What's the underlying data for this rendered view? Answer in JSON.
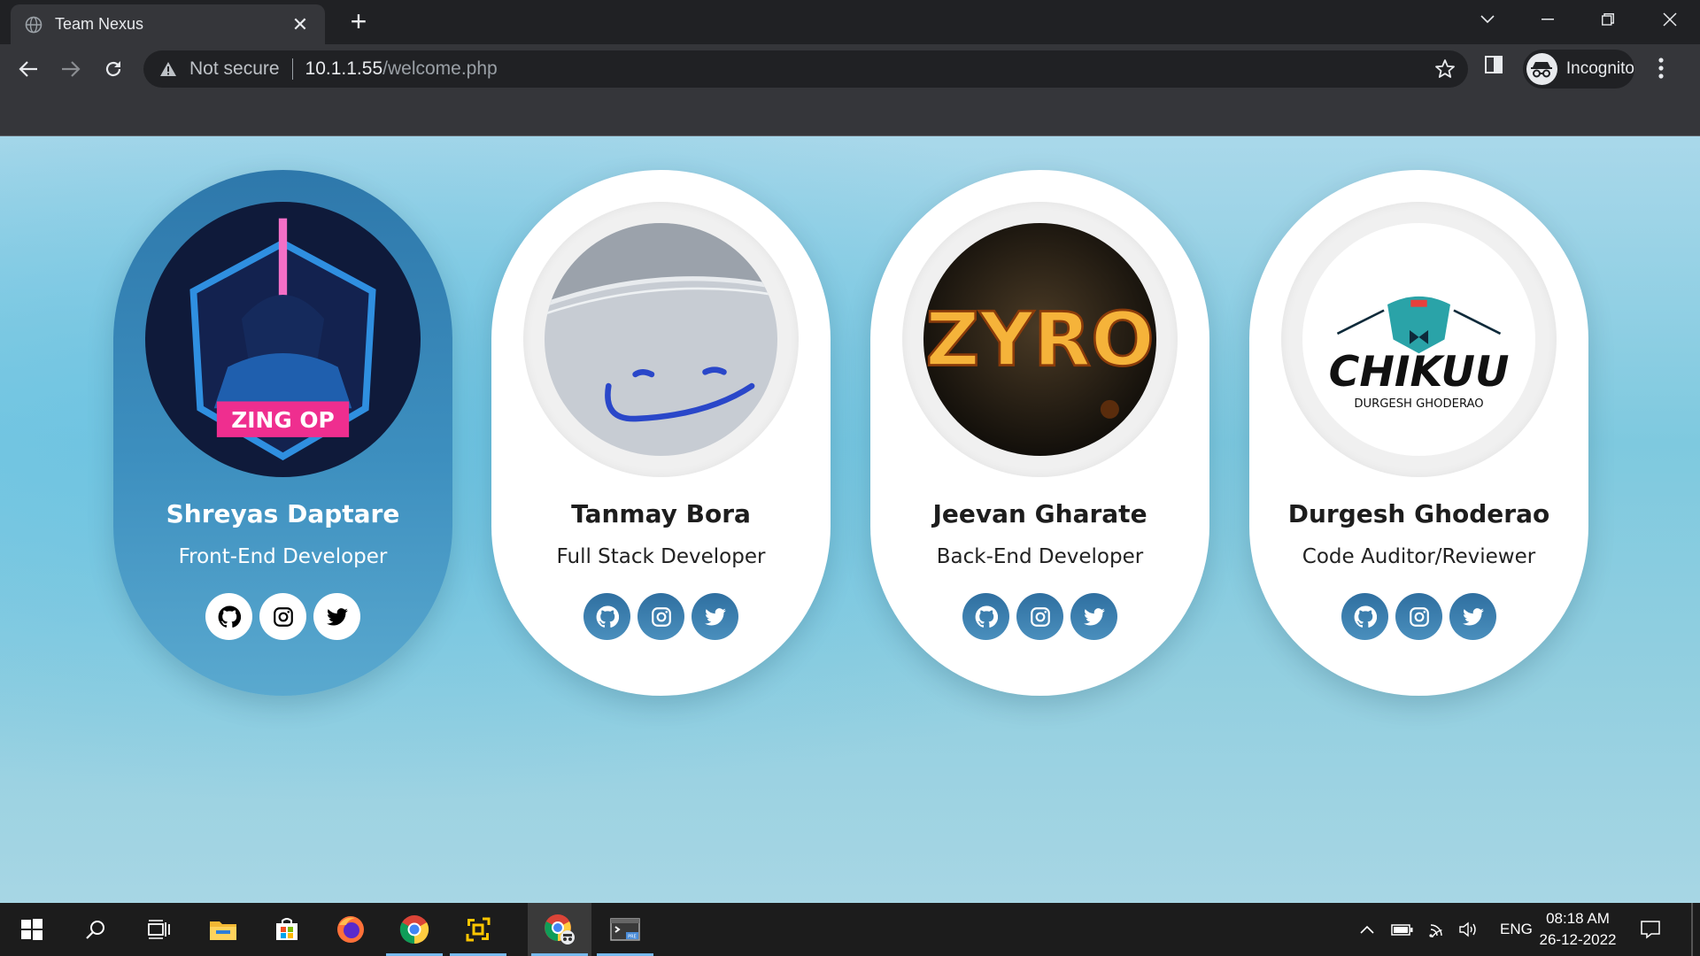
{
  "browser": {
    "tab_title": "Team Nexus",
    "new_tab_symbol": "+",
    "close_symbol": "✕",
    "security_label": "Not secure",
    "url_host": "10.1.1.55",
    "url_path": "/welcome.php",
    "profile_label": "Incognito"
  },
  "team": [
    {
      "name": "Shreyas Daptare",
      "role": "Front-End Developer",
      "avatar": "zing-op-logo",
      "avatar_text": "ZING OP",
      "highlighted": true
    },
    {
      "name": "Tanmay Bora",
      "role": "Full Stack Developer",
      "avatar": "smiley-drawing"
    },
    {
      "name": "Jeevan Gharate",
      "role": "Back-End Developer",
      "avatar": "zyro-logo",
      "avatar_text": "ZYRO"
    },
    {
      "name": "Durgesh Ghoderao",
      "role": "Code Auditor/Reviewer",
      "avatar": "chikuu-logo",
      "avatar_text": "CHIKUU",
      "avatar_subtext": "DURGESH GHODERAO"
    }
  ],
  "social_icons": [
    "github-icon",
    "instagram-icon",
    "twitter-icon"
  ],
  "taskbar": {
    "apps": [
      "windows-start-icon",
      "search-icon",
      "task-view-icon",
      "file-explorer-icon",
      "microsoft-store-icon",
      "firefox-icon",
      "chrome-icon",
      "virtualbox-icon",
      "chrome-incognito-icon",
      "terminal-preview-icon"
    ],
    "language": "ENG",
    "time": "08:18 AM",
    "date": "26-12-2022"
  },
  "colors": {
    "chrome_dark": "#202124",
    "chrome_toolbar": "#35363a",
    "card_active": "#3d8fbf",
    "social_button": "#3a7fb0"
  }
}
